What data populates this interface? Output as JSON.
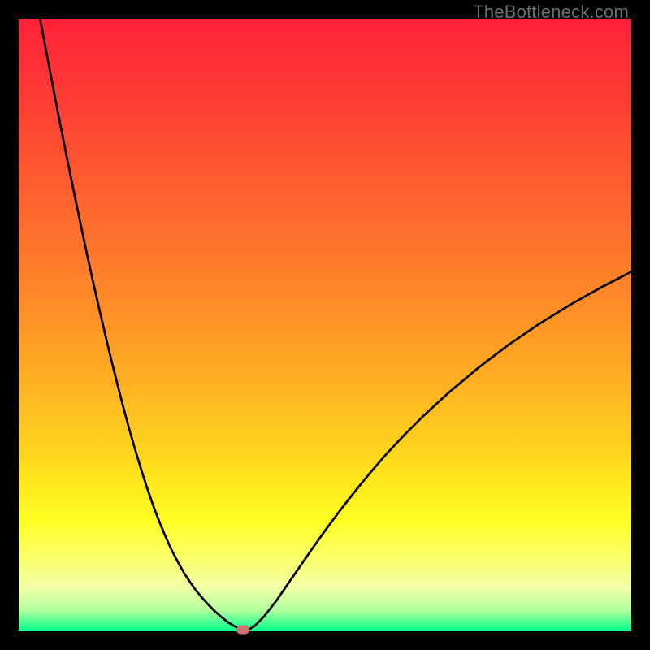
{
  "watermark": "TheBottleneck.com",
  "chart_data": {
    "type": "line",
    "title": "",
    "xlabel": "",
    "ylabel": "",
    "xlim": [
      0,
      100
    ],
    "ylim": [
      0,
      100
    ],
    "grid": false,
    "legend": false,
    "background_gradient_stops": [
      {
        "offset": 0.0,
        "color": "#fe2238"
      },
      {
        "offset": 0.12,
        "color": "#fe3b35"
      },
      {
        "offset": 0.24,
        "color": "#fe5630"
      },
      {
        "offset": 0.36,
        "color": "#fe722d"
      },
      {
        "offset": 0.48,
        "color": "#fe9027"
      },
      {
        "offset": 0.58,
        "color": "#fead23"
      },
      {
        "offset": 0.68,
        "color": "#fecc1f"
      },
      {
        "offset": 0.76,
        "color": "#fee81c"
      },
      {
        "offset": 0.82,
        "color": "#feff24"
      },
      {
        "offset": 0.88,
        "color": "#faff69"
      },
      {
        "offset": 0.93,
        "color": "#f1ffa8"
      },
      {
        "offset": 0.965,
        "color": "#b3ff9c"
      },
      {
        "offset": 0.985,
        "color": "#4dff93"
      },
      {
        "offset": 1.0,
        "color": "#02ff8b"
      }
    ],
    "series": [
      {
        "name": "bottleneck-curve",
        "color": "#000000",
        "stroke_width": 2.7,
        "x": [
          3.5,
          4,
          5,
          6,
          7,
          8,
          9,
          10,
          11,
          12,
          13,
          14,
          15,
          16,
          17,
          18,
          19,
          20,
          21,
          22,
          23,
          24,
          25,
          26,
          27,
          28,
          29,
          30,
          31,
          32,
          33,
          34,
          35,
          36,
          36.9,
          37.5,
          38.5,
          40,
          42,
          44,
          46,
          48,
          50,
          52,
          54,
          56,
          58,
          60,
          63,
          66,
          70,
          75,
          80,
          85,
          90,
          95,
          100
        ],
        "y": [
          100,
          97.3,
          92.0,
          86.8,
          81.7,
          76.7,
          71.8,
          67.0,
          62.3,
          57.7,
          53.3,
          49.0,
          44.8,
          40.8,
          36.9,
          33.2,
          29.7,
          26.4,
          23.3,
          20.4,
          17.8,
          15.4,
          13.2,
          11.3,
          9.5,
          8.0,
          6.6,
          5.4,
          4.3,
          3.3,
          2.4,
          1.6,
          0.95,
          0.45,
          0.13,
          0.25,
          0.85,
          2.35,
          4.9,
          7.8,
          10.7,
          13.6,
          16.4,
          19.1,
          21.7,
          24.2,
          26.6,
          28.9,
          32.1,
          35.1,
          38.8,
          43.0,
          46.8,
          50.2,
          53.3,
          56.1,
          58.7
        ]
      }
    ],
    "marker": {
      "x": 36.6,
      "y": 0.3,
      "color": "#cd7371"
    }
  }
}
